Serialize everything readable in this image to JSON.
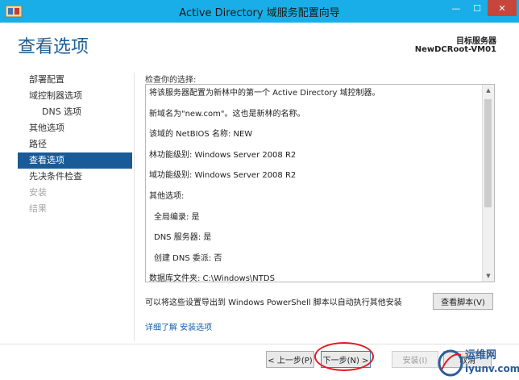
{
  "window": {
    "title": "Active Directory 域服务配置向导",
    "minimize_symbol": "—",
    "maximize_symbol": "☐",
    "close_symbol": "✕"
  },
  "header": {
    "title": "查看选项",
    "target_label": "目标服务器",
    "target_value": "NewDCRoot-VM01"
  },
  "nav": {
    "items": [
      {
        "label": "部署配置",
        "state": "normal"
      },
      {
        "label": "域控制器选项",
        "state": "normal"
      },
      {
        "label": "DNS 选项",
        "state": "sub"
      },
      {
        "label": "其他选项",
        "state": "normal"
      },
      {
        "label": "路径",
        "state": "normal"
      },
      {
        "label": "查看选项",
        "state": "active"
      },
      {
        "label": "先决条件检查",
        "state": "normal"
      },
      {
        "label": "安装",
        "state": "disabled"
      },
      {
        "label": "结果",
        "state": "disabled"
      }
    ]
  },
  "review": {
    "label": "检查你的选择:",
    "lines": [
      "将该服务器配置为新林中的第一个 Active Directory 域控制器。",
      "新域名为\"new.com\"。这也是新林的名称。",
      "该域的 NetBIOS 名称: NEW",
      "林功能级别: Windows Server 2008 R2",
      "域功能级别: Windows Server 2008 R2",
      "其他选项:",
      "全局编录: 是",
      "DNS 服务器: 是",
      "创建 DNS 委派: 否",
      "数据库文件夹: C:\\Windows\\NTDS"
    ]
  },
  "export": {
    "text": "可以将这些设置导出到 Windows PowerShell 脚本以自动执行其他安装",
    "view_script_label": "查看脚本(V)"
  },
  "more_link": "详细了解 安装选项",
  "footer": {
    "prev_label": "< 上一步(P)",
    "next_label": "下一步(N) >",
    "install_label": "安装(I)",
    "cancel_label": "取消"
  },
  "watermark": {
    "line1": "运维网",
    "line2": "iyunv.com"
  },
  "colors": {
    "titlebar": "#19aee8",
    "accent": "#1a5a96",
    "title_blue": "#1f5f95",
    "highlight_ring": "#e01b24"
  }
}
